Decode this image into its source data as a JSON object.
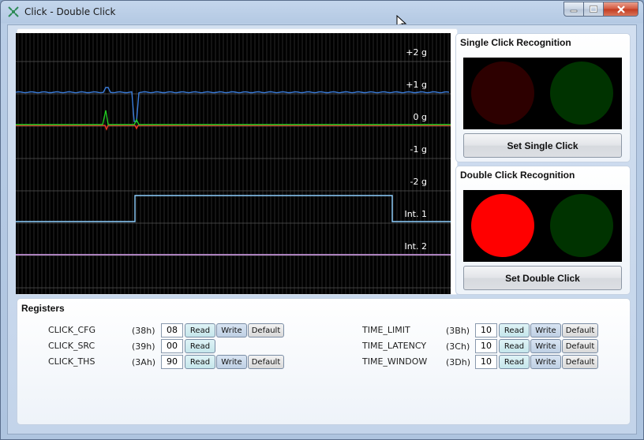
{
  "window": {
    "title": "Click - Double Click"
  },
  "graph": {
    "labels": [
      "+2 g",
      "+1 g",
      "0 g",
      "-1 g",
      "-2 g",
      "Int. 1",
      "Int. 2"
    ],
    "colors": {
      "x_axis": "#3b7ddb",
      "y_axis": "#22cc22",
      "z_axis": "#ee3322",
      "int1": "#8ecfff",
      "int2": "#d8a0f0",
      "grid": "#444444"
    }
  },
  "single_click": {
    "title": "Single Click Recognition",
    "led1_color": "#2d0000",
    "led2_color": "#003300",
    "button": "Set Single Click"
  },
  "double_click": {
    "title": "Double Click Recognition",
    "led1_color": "#ff0000",
    "led2_color": "#003300",
    "button": "Set Double Click"
  },
  "registers": {
    "title": "Registers",
    "read_label": "Read",
    "write_label": "Write",
    "default_label": "Default",
    "left": [
      {
        "name": "CLICK_CFG",
        "addr": "(38h)",
        "value": "08"
      },
      {
        "name": "CLICK_SRC",
        "addr": "(39h)",
        "value": "00"
      },
      {
        "name": "CLICK_THS",
        "addr": "(3Ah)",
        "value": "90"
      }
    ],
    "right": [
      {
        "name": "TIME_LIMIT",
        "addr": "(3Bh)",
        "value": "10"
      },
      {
        "name": "TIME_LATENCY",
        "addr": "(3Ch)",
        "value": "10"
      },
      {
        "name": "TIME_WINDOW",
        "addr": "(3Dh)",
        "value": "10"
      }
    ]
  }
}
